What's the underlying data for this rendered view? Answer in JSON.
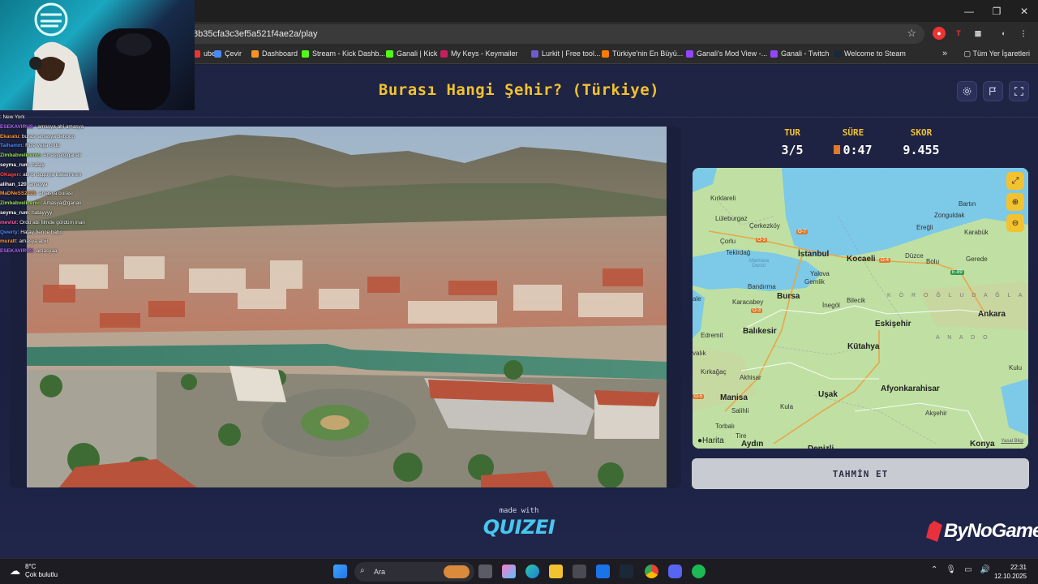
{
  "browser": {
    "url": "8b35cfa3c3ef5a521f4ae2a/play",
    "bookmarks": [
      {
        "label": "ube",
        "color": "#e33"
      },
      {
        "label": "Çevir",
        "color": "#4a8af4"
      },
      {
        "label": "Dashboard",
        "color": "#f7931e"
      },
      {
        "label": "Stream - Kick Dashb...",
        "color": "#53fc18"
      },
      {
        "label": "Ganali | Kick",
        "color": "#53fc18"
      },
      {
        "label": "My Keys - Keymailer",
        "color": "#c51f5d"
      },
      {
        "label": "Lurkit | Free tool...",
        "color": "#6d5bd0"
      },
      {
        "label": "Türkiye'nin En Büyü...",
        "color": "#ff7a00"
      },
      {
        "label": "Ganali's Mod View -...",
        "color": "#9146ff"
      },
      {
        "label": "Ganali - Twitch",
        "color": "#9146ff"
      },
      {
        "label": "Welcome to Steam",
        "color": "#1b2838"
      }
    ],
    "all_bookmarks": "Tüm Yer İşaretleri"
  },
  "game": {
    "title": "Burası Hangi Şehir? (Türkiye)",
    "stats": {
      "round_label": "TUR",
      "round_value": "3/5",
      "time_label": "SÜRE",
      "time_value": "0:47",
      "score_label": "SKOR",
      "score_value": "9.455"
    },
    "guess_button": "TAHMİN ET",
    "made_with": "made with",
    "quizei": "QUIZEI",
    "sponsor": "ByNoGame"
  },
  "map": {
    "attribution": "Harita",
    "legal": "Yasal Bilgi",
    "cities": [
      {
        "name": "Kırklareli",
        "big": false
      },
      {
        "name": "Lüleburgaz",
        "big": false
      },
      {
        "name": "Çerkezköy",
        "big": false
      },
      {
        "name": "Bartın",
        "big": false
      },
      {
        "name": "Zonguldak",
        "big": false
      },
      {
        "name": "Ereğli",
        "big": false
      },
      {
        "name": "Karabük",
        "big": false
      },
      {
        "name": "Çorlu",
        "big": false
      },
      {
        "name": "İstanbul",
        "big": true
      },
      {
        "name": "Tekirdağ",
        "big": false
      },
      {
        "name": "Kocaeli",
        "big": true
      },
      {
        "name": "Düzce",
        "big": false
      },
      {
        "name": "Bolu",
        "big": false
      },
      {
        "name": "Gerede",
        "big": false
      },
      {
        "name": "Gemlik",
        "big": false
      },
      {
        "name": "Yalova",
        "big": false
      },
      {
        "name": "Bandırma",
        "big": false
      },
      {
        "name": "Bursa",
        "big": true
      },
      {
        "name": "Karacabey",
        "big": false
      },
      {
        "name": "İnegöl",
        "big": false
      },
      {
        "name": "Bilecik",
        "big": false
      },
      {
        "name": "Eskişehir",
        "big": true
      },
      {
        "name": "Ankara",
        "big": true
      },
      {
        "name": "Edremit",
        "big": false
      },
      {
        "name": "Balıkesir",
        "big": true
      },
      {
        "name": "Kütahya",
        "big": true
      },
      {
        "name": "Kırkağaç",
        "big": false
      },
      {
        "name": "Akhisar",
        "big": false
      },
      {
        "name": "Manisa",
        "big": true
      },
      {
        "name": "Uşak",
        "big": true
      },
      {
        "name": "Afyonkarahisar",
        "big": true
      },
      {
        "name": "Salihli",
        "big": false
      },
      {
        "name": "Kula",
        "big": false
      },
      {
        "name": "Akşehir",
        "big": false
      },
      {
        "name": "Torbalı",
        "big": false
      },
      {
        "name": "Tire",
        "big": false
      },
      {
        "name": "Aydın",
        "big": true
      },
      {
        "name": "Denizli",
        "big": true
      },
      {
        "name": "Konya",
        "big": true
      },
      {
        "name": "Kulu",
        "big": false
      },
      {
        "name": "valık",
        "big": false
      },
      {
        "name": "ale",
        "big": false
      }
    ],
    "sea_label": "Marmara Denizi",
    "region_labels": [
      "K Ö R O Ğ L U   D A Ğ L A",
      "A N A D O"
    ],
    "road_badges": [
      "O-3",
      "O-7",
      "O-4",
      "E-89",
      "O-3",
      "O-5"
    ]
  },
  "chat": [
    {
      "user": "",
      "text": ": New York",
      "color": "#ff5cae"
    },
    {
      "user": "ESEKAVIRUS ",
      "text": ": amasya abi amasya",
      "color": "#b36bff"
    },
    {
      "user": "Ekaratu",
      "text": ": burası amasya bebooo",
      "color": "#ff9a3c"
    },
    {
      "user": "Talhamm",
      "text": ": Rize veya ordu",
      "color": "#4d8bff"
    },
    {
      "user": "Zimbabvelicemo",
      "text": ": Amasya@ganali",
      "color": "#9fe25a"
    },
    {
      "user": "seyma_rum",
      "text": ": hatay",
      "color": "#ffffff"
    },
    {
      "user": "OKagen",
      "text": ": abi bi dcgu'ya bakarmısın",
      "color": "#ff4d4d"
    },
    {
      "user": "alihan_120",
      "text": ": amasya",
      "color": "#ffffff"
    },
    {
      "user": "MaDNeSS2121",
      "text": ": amasya burası",
      "color": "#ff9a3c"
    },
    {
      "user": "Zimbabvelicemo",
      "text": ": Amasya@ganali",
      "color": "#9fe25a"
    },
    {
      "user": "seyma_rum",
      "text": ": hatayyyy",
      "color": "#ffffff"
    },
    {
      "user": "mevlut",
      "text": ": Ordu abi filmde gördüm inan",
      "color": "#ff5cae"
    },
    {
      "user": "Qwerty",
      "text": ": Hatay bence babo",
      "color": "#4d8bff"
    },
    {
      "user": "muratt",
      "text": ": amasya abiii",
      "color": "#ff9a3c"
    },
    {
      "user": "ESEKAVIRUS",
      "text": ": amasyaa",
      "color": "#b36bff"
    }
  ],
  "taskbar": {
    "temp": "8°C",
    "weather": "Çok bulutlu",
    "search_placeholder": "Ara",
    "time": "22:31",
    "date": "12.10.2025"
  }
}
